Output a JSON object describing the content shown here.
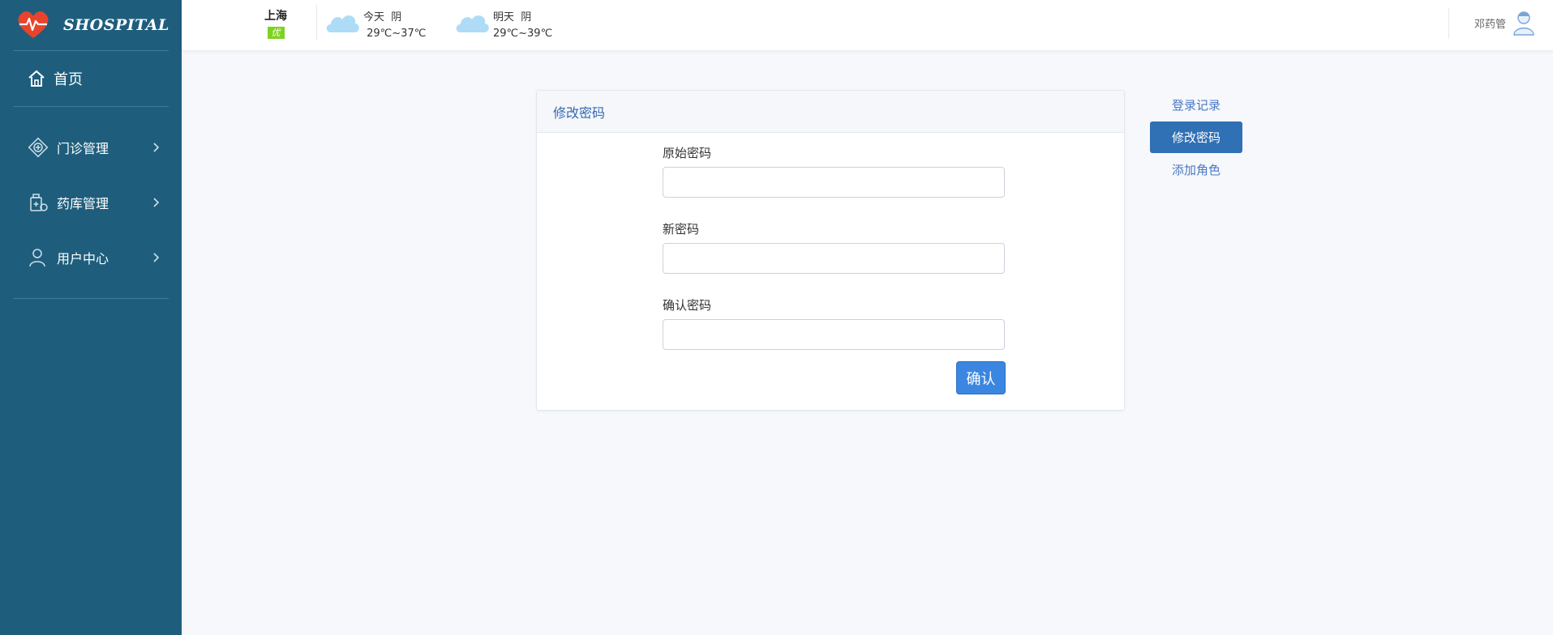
{
  "app": {
    "logo_text": "SHOSPITAL"
  },
  "sidebar": {
    "home_label": "首页",
    "items": [
      {
        "label": "门诊管理",
        "icon": "clinic-icon"
      },
      {
        "label": "药库管理",
        "icon": "pharmacy-icon"
      },
      {
        "label": "用户中心",
        "icon": "user-icon"
      }
    ]
  },
  "header": {
    "city": "上海",
    "aqi": "优",
    "today": {
      "label": "今天",
      "condition": "阴",
      "temp": "29℃~37℃"
    },
    "tomorrow": {
      "label": "明天",
      "condition": "阴",
      "temp": "29℃~39℃"
    },
    "user_name": "邓药管"
  },
  "card": {
    "title": "修改密码",
    "fields": [
      {
        "label": "原始密码",
        "value": "",
        "placeholder": ""
      },
      {
        "label": "新密码",
        "value": "",
        "placeholder": ""
      },
      {
        "label": "确认密码",
        "value": "",
        "placeholder": ""
      }
    ],
    "confirm_label": "确认"
  },
  "rightnav": {
    "items": [
      "登录记录",
      "修改密码",
      "添加角色"
    ],
    "active_index": 1
  },
  "colors": {
    "sidebar_bg": "#1e5e7c",
    "accent": "#3070b5",
    "button": "#3b86e0",
    "aqi_good": "#7ed321"
  }
}
